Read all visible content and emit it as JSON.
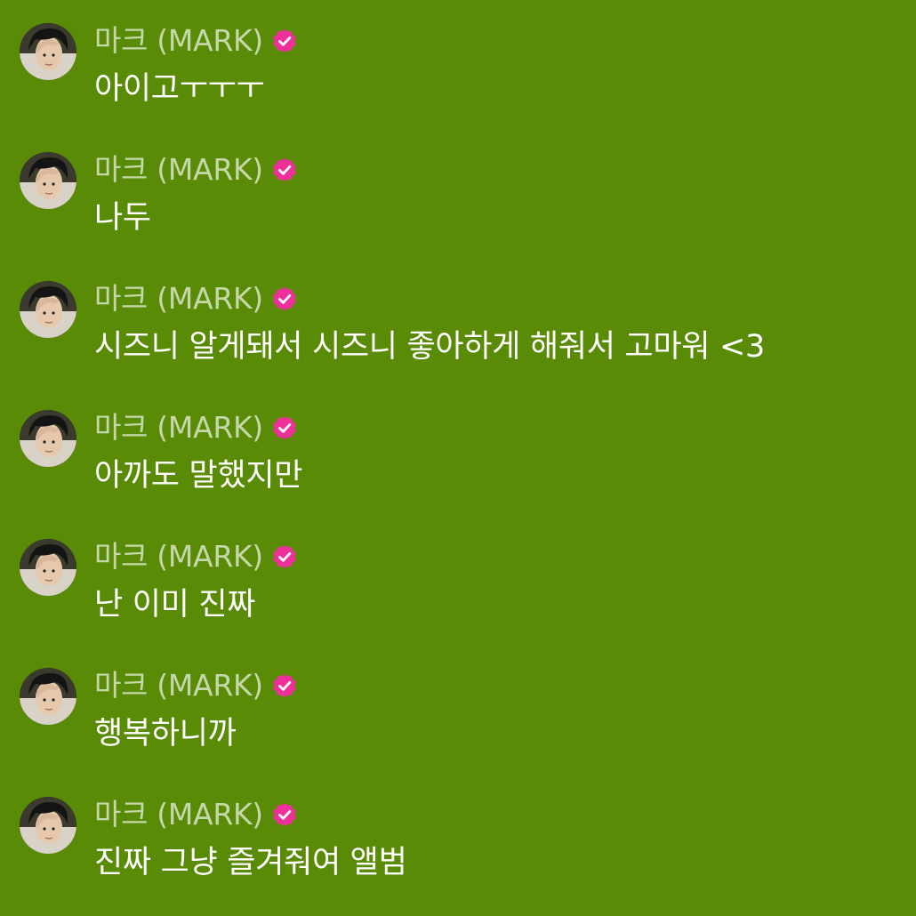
{
  "colors": {
    "background": "#5a8b07",
    "badge": "#f0309a",
    "name_text": "#c9dcb0",
    "message_text": "#ffffff"
  },
  "messages": [
    {
      "sender": "마크 (MARK)",
      "verified_icon": "verified-check-icon",
      "text": "아이고ㅜㅜㅜ"
    },
    {
      "sender": "마크 (MARK)",
      "verified_icon": "verified-check-icon",
      "text": "나두"
    },
    {
      "sender": "마크 (MARK)",
      "verified_icon": "verified-check-icon",
      "text": "시즈니 알게돼서 시즈니 좋아하게 해줘서 고마워 <3"
    },
    {
      "sender": "마크 (MARK)",
      "verified_icon": "verified-check-icon",
      "text": "아까도 말했지만"
    },
    {
      "sender": "마크 (MARK)",
      "verified_icon": "verified-check-icon",
      "text": "난 이미 진짜"
    },
    {
      "sender": "마크 (MARK)",
      "verified_icon": "verified-check-icon",
      "text": "행복하니까"
    },
    {
      "sender": "마크 (MARK)",
      "verified_icon": "verified-check-icon",
      "text": "진짜 그냥 즐겨줘여 앨범"
    }
  ]
}
